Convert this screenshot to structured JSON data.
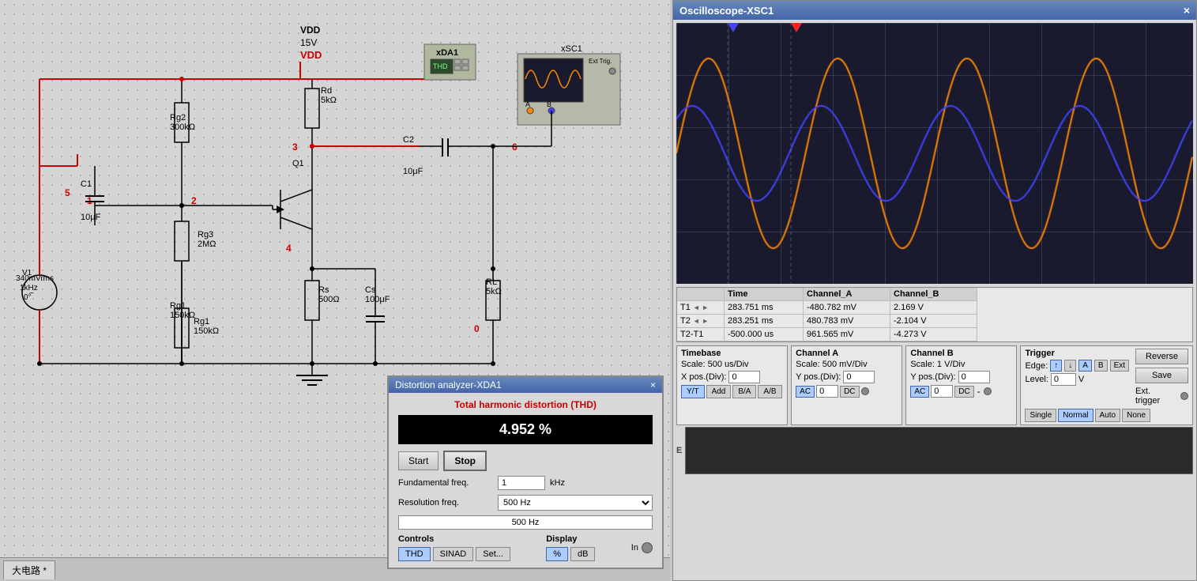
{
  "circuit": {
    "title": "大电路",
    "tab_label": "大电路 *",
    "components": {
      "VDD": {
        "label": "VDD",
        "value": "15V",
        "color": "red"
      },
      "V1": {
        "label": "V1",
        "value1": "340mVrms",
        "value2": "1kHz",
        "value3": "0°"
      },
      "Rg2": {
        "label": "Rg2",
        "value": "300kΩ"
      },
      "Rg3": {
        "label": "Rg3",
        "value": "2MΩ"
      },
      "Rg1": {
        "label": "Rg1",
        "value": "150kΩ"
      },
      "Rd": {
        "label": "Rd",
        "value": "5kΩ"
      },
      "Rs": {
        "label": "Rs",
        "value": "500Ω"
      },
      "RL": {
        "label": "RL",
        "value": "5kΩ"
      },
      "C1": {
        "label": "C1",
        "value": "10μF"
      },
      "C2": {
        "label": "C2",
        "value": "10μF"
      },
      "Cs": {
        "label": "Cs",
        "value": "100μF"
      },
      "Q1": {
        "label": "Q1"
      },
      "XDA1": {
        "label": "XDA1",
        "sub": "THD"
      },
      "XSC1": {
        "label": "xSC1"
      },
      "nodes": {
        "n1": "1",
        "n2": "2",
        "n3": "3",
        "n4": "4",
        "n5": "5",
        "n6": "6",
        "n0": "0"
      }
    }
  },
  "oscilloscope": {
    "title": "Oscilloscope-XSC1",
    "close_label": "×",
    "timing": {
      "headers": [
        "",
        "Time",
        "Channel_A",
        "Channel_B"
      ],
      "t1": {
        "label": "T1",
        "time": "283.751 ms",
        "ch_a": "-480.782 mV",
        "ch_b": "2.169 V"
      },
      "t2": {
        "label": "T2",
        "time": "283.251 ms",
        "ch_a": "480.783 mV",
        "ch_b": "-2.104 V"
      },
      "t2_t1": {
        "label": "T2-T1",
        "time": "-500.000 us",
        "ch_a": "961.565 mV",
        "ch_b": "-4.273 V"
      }
    },
    "timebase": {
      "label": "Timebase",
      "scale_label": "Scale:",
      "scale_value": "500 us/Div",
      "xpos_label": "X pos.(Div):",
      "xpos_value": "0"
    },
    "channel_a": {
      "label": "Channel A",
      "scale_label": "Scale:",
      "scale_value": "500 mV/Div",
      "ypos_label": "Y pos.(Div):",
      "ypos_value": "0"
    },
    "channel_b": {
      "label": "Channel B",
      "scale_label": "Scale:",
      "scale_value": "1 V/Div",
      "ypos_label": "Y pos.(Div):",
      "ypos_value": "0"
    },
    "trigger": {
      "label": "Trigger",
      "edge_label": "Edge:",
      "level_label": "Level:",
      "level_value": "0",
      "level_unit": "V"
    },
    "buttons": {
      "reverse": "Reverse",
      "save": "Save",
      "yt": "Y/T",
      "add": "Add",
      "ba": "B/A",
      "ab": "A/B",
      "ac_a": "AC",
      "dc_a": "DC",
      "ac_b": "AC",
      "dc_b": "DC",
      "minus_b": "-",
      "single": "Single",
      "normal": "Normal",
      "auto": "Auto",
      "none": "None",
      "edge_rise": "↑",
      "edge_fall": "↓",
      "chan_a": "A",
      "chan_b": "B",
      "chan_ext": "Ext",
      "ext_trigger_label": "Ext. trigger",
      "val_0_a": "0",
      "val_0_b": "0"
    },
    "waveform": {
      "orange_amplitude": 120,
      "blue_amplitude": 60,
      "frequency_ratio": 1
    }
  },
  "distortion_analyzer": {
    "title": "Distortion analyzer-XDA1",
    "close_label": "×",
    "thd_title": "Total harmonic distortion (THD)",
    "thd_value": "4.952 %",
    "fundamental_freq_label": "Fundamental freq.",
    "fundamental_freq_value": "1",
    "fundamental_freq_unit": "kHz",
    "resolution_freq_label": "Resolution freq.",
    "resolution_freq_value": "500 Hz",
    "resolution_freq_display": "500 Hz",
    "buttons": {
      "start": "Start",
      "stop": "Stop",
      "thd": "THD",
      "sinad": "SINAD",
      "set": "Set...",
      "percent": "%",
      "db": "dB"
    },
    "controls_label": "Controls",
    "display_label": "Display",
    "in_label": "In"
  }
}
